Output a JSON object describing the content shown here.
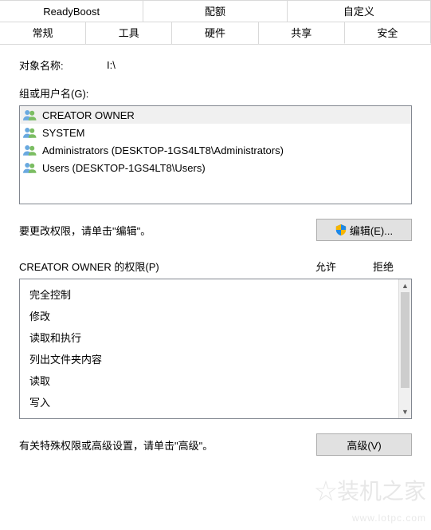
{
  "tabs_row1": [
    {
      "label": "ReadyBoost"
    },
    {
      "label": "配额"
    },
    {
      "label": "自定义"
    }
  ],
  "tabs_row2": [
    {
      "label": "常规"
    },
    {
      "label": "工具"
    },
    {
      "label": "硬件"
    },
    {
      "label": "共享"
    },
    {
      "label": "安全",
      "active": true
    }
  ],
  "object_label": "对象名称:",
  "object_value": "I:\\",
  "group_label": "组或用户名(G):",
  "principals": [
    {
      "name": "CREATOR OWNER",
      "selected": true
    },
    {
      "name": "SYSTEM"
    },
    {
      "name": "Administrators (DESKTOP-1GS4LT8\\Administrators)"
    },
    {
      "name": "Users (DESKTOP-1GS4LT8\\Users)"
    }
  ],
  "edit_hint": "要更改权限，请单击\"编辑\"。",
  "edit_button": "编辑(E)...",
  "perm_for_label": "CREATOR OWNER 的权限(P)",
  "col_allow": "允许",
  "col_deny": "拒绝",
  "permissions": [
    "完全控制",
    "修改",
    "读取和执行",
    "列出文件夹内容",
    "读取",
    "写入"
  ],
  "adv_hint": "有关特殊权限或高级设置，请单击\"高级\"。",
  "adv_button": "高级(V)",
  "watermark_main": "装机之家",
  "watermark_sub": "www.lotpc.com"
}
